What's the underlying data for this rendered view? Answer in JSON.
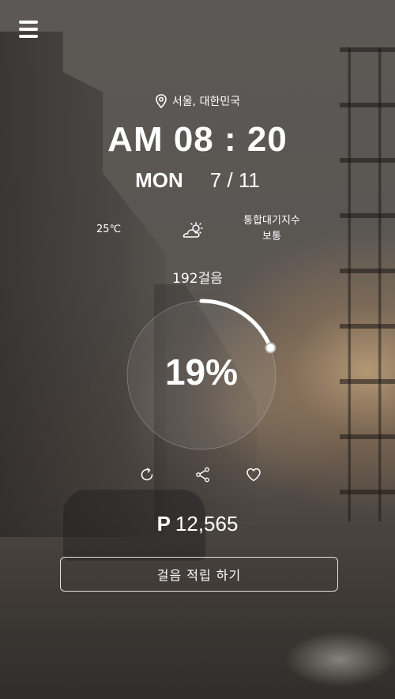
{
  "header": {
    "menu_icon": "hamburger-menu-icon"
  },
  "location": {
    "icon": "location-pin-icon",
    "text": "서울, 대한민국"
  },
  "clock": {
    "time": "AM 08 : 20",
    "day_of_week": "MON",
    "date": "7 / 11"
  },
  "weather": {
    "temperature": "25℃",
    "condition_icon": "partly-sunny-icon",
    "aqi_label": "통합대기지수",
    "aqi_value": "보통"
  },
  "activity": {
    "steps_text": "192걸음",
    "progress_percent_text": "19%",
    "progress_fraction": 0.19,
    "colors": {
      "gauge_track_fill": "#ffffff",
      "gauge_arc": "#ffffff"
    }
  },
  "actions": {
    "refresh_icon": "refresh-icon",
    "share_icon": "share-icon",
    "like_icon": "heart-icon"
  },
  "points": {
    "symbol": "P",
    "amount": "12,565"
  },
  "cta": {
    "label": "걸음 적립 하기"
  }
}
